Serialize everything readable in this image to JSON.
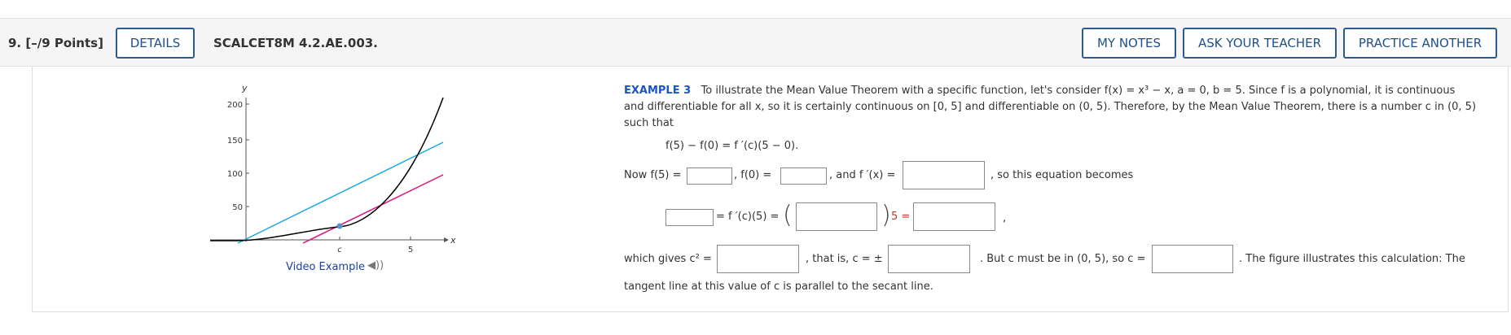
{
  "header": {
    "question_number": "9.",
    "points": "[–/9 Points]",
    "details_label": "DETAILS",
    "code": "SCALCET8M 4.2.AE.003.",
    "my_notes_label": "MY NOTES",
    "ask_teacher_label": "ASK YOUR TEACHER",
    "practice_label": "PRACTICE ANOTHER"
  },
  "figure": {
    "y_axis_label": "y",
    "x_axis_label": "x",
    "y_ticks": [
      "200",
      "150",
      "100",
      "50"
    ],
    "x_tick_c": "c",
    "x_tick_5": "5",
    "colors": {
      "curve": "#000000",
      "secant": "#19a8e0",
      "tangent": "#d6177a",
      "point": "#5a8fd0"
    },
    "video_link": "Video Example",
    "speaker_icon": "speaker-icon"
  },
  "example": {
    "label": "EXAMPLE 3",
    "line1": "To illustrate the Mean Value Theorem with a specific function, let's consider f(x) = x³ − x, a = 0, b = 5. Since f is a polynomial, it is continuous",
    "line2": "and differentiable for all x, so it is certainly continuous on [0, 5] and differentiable on (0, 5). Therefore, by the Mean Value Theorem, there is a number c in (0, 5)",
    "line3": "such that",
    "equation": "f(5) − f(0) = f ′(c)(5 − 0).",
    "now_f5": "Now f(5) =",
    "f0": ", f(0) =",
    "and_fprime": ", and f ′(x) =",
    "so_becomes": ", so this equation becomes",
    "eq2_mid": "= f ′(c)(5) =",
    "eq2_after": "5 =",
    "eq2_comma": ",",
    "which_gives": "which gives c² =",
    "that_is": ", that is, c = ±",
    "but_c": ". But c must be in (0, 5), so c =",
    "figure_ill": ". The figure illustrates this calculation: The",
    "last_line": "tangent line at this value of c is parallel to the secant line."
  },
  "inputs": {
    "f5": "",
    "f0": "",
    "fprime": "",
    "lhs": "",
    "paren": "",
    "rhs": "",
    "c2": "",
    "c_pm": "",
    "c": ""
  }
}
